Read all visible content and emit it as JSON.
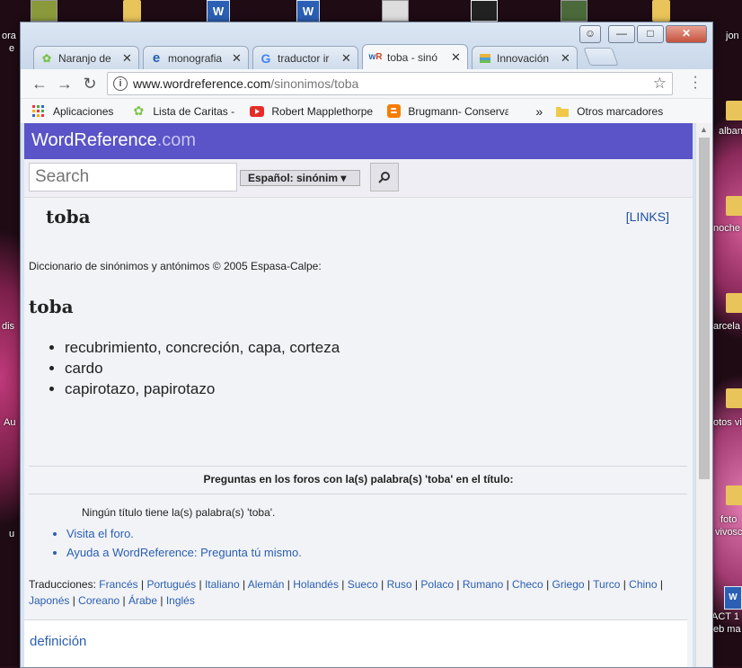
{
  "desktop": {
    "left_labels": [
      "ora",
      "e",
      "dis",
      "Au",
      "u"
    ],
    "right_labels": [
      "jon",
      "alban",
      "noche",
      "arcela",
      "otos vi",
      "foto",
      "vivosc",
      "ACT 1",
      "eb ma"
    ]
  },
  "browser": {
    "tabs": [
      {
        "title": "Naranjo de",
        "icon": "leaf-icon",
        "active": false
      },
      {
        "title": "monografia",
        "icon": "ie-e-icon",
        "active": false
      },
      {
        "title": "traductor ir",
        "icon": "google-g-icon",
        "active": false
      },
      {
        "title": "toba - sinó",
        "icon": "wr-icon",
        "active": true
      },
      {
        "title": "Innovación",
        "icon": "stack-icon",
        "active": false
      }
    ],
    "address": {
      "host": "www.wordreference.com",
      "path": "/sinonimos/toba"
    },
    "bookmarks": [
      {
        "label": "Aplicaciones",
        "icon": "apps-grid-icon"
      },
      {
        "label": "Lista de Caritas - Foro",
        "icon": "leaf-icon"
      },
      {
        "label": "Robert Mapplethorpe",
        "icon": "youtube-icon"
      },
      {
        "label": "Brugmann- Conservat",
        "icon": "blogger-icon"
      }
    ],
    "more_bookmarks": "»",
    "other_bookmarks": "Otros marcadores"
  },
  "page": {
    "logo_main": "WordReference",
    "logo_suffix": ".com",
    "search_placeholder": "Search",
    "dictionary_select": "Español: sinónim",
    "headword": "toba",
    "links_open": "[",
    "links_label": "LINKS",
    "links_close": "]",
    "source": "Diccionario de sinónimos y antónimos © 2005 Espasa-Calpe:",
    "entry_word": "toba",
    "synonyms": [
      "recubrimiento, concreción, capa, corteza",
      "cardo",
      "capirotazo, papirotazo"
    ],
    "forum_heading": "Preguntas en los foros con la(s) palabra(s) 'toba' en el título:",
    "no_title": "Ningún título tiene la(s) palabra(s) 'toba'.",
    "forum_links": [
      "Visita el foro.",
      "Ayuda a WordReference: Pregunta tú mismo."
    ],
    "translations_label": "Traducciones:",
    "translations": [
      "Francés",
      "Portugués",
      "Italiano",
      "Alemán",
      "Holandés",
      "Sueco",
      "Ruso",
      "Polaco",
      "Rumano",
      "Checo",
      "Griego",
      "Turco",
      "Chino",
      "Japonés",
      "Coreano",
      "Árabe",
      "Inglés"
    ],
    "definition_link": "definición"
  }
}
